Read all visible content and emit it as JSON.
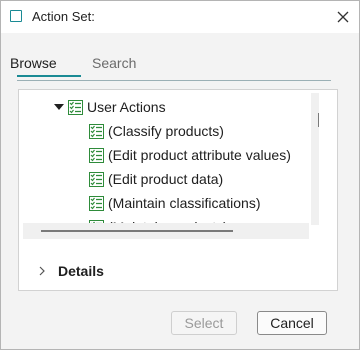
{
  "window": {
    "title": "Action Set:"
  },
  "tabs": [
    {
      "label": "Browse",
      "active": true
    },
    {
      "label": "Search",
      "active": false
    }
  ],
  "tree": {
    "root": {
      "label": "User Actions",
      "expanded": true
    },
    "items": [
      {
        "label": "(Classify products)"
      },
      {
        "label": "(Edit product attribute values)"
      },
      {
        "label": "(Edit product data)"
      },
      {
        "label": "(Maintain classifications)"
      },
      {
        "label": "(Maintain products)"
      }
    ]
  },
  "details": {
    "label": "Details",
    "expanded": false
  },
  "buttons": {
    "select_label": "Select",
    "cancel_label": "Cancel"
  },
  "colors": {
    "accent": "#1a8a94",
    "icon_green": "#2e8b3a"
  }
}
